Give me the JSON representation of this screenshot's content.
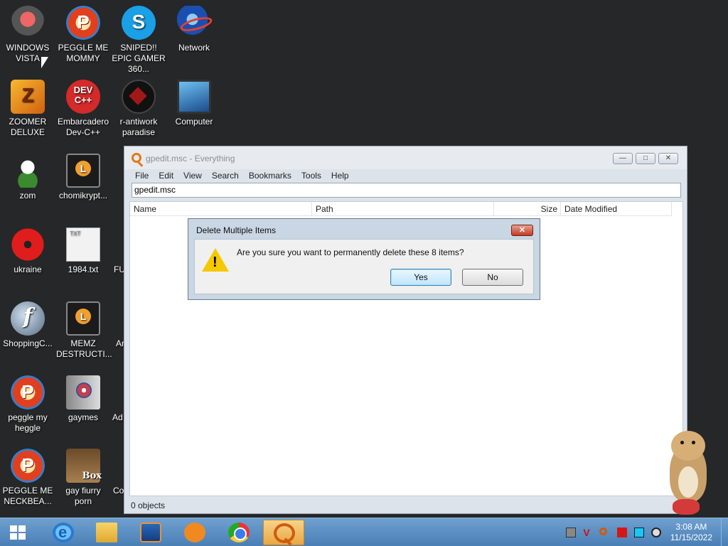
{
  "desktop_icons": [
    {
      "label": "WINDOWS VISTA",
      "icon": "windows-vista-icon"
    },
    {
      "label": "PEGGLE ME MOMMY",
      "icon": "peggle-icon"
    },
    {
      "label": "SNIPED!! EPIC GAMER 360...",
      "icon": "skype-icon"
    },
    {
      "label": "Network",
      "icon": "network-icon"
    },
    {
      "label": "ZOOMER DELUXE",
      "icon": "zoomer-icon"
    },
    {
      "label": "Embarcadero Dev-C++",
      "icon": "devcpp-icon"
    },
    {
      "label": "r-antiwork paradise",
      "icon": "antiwork-icon"
    },
    {
      "label": "Computer",
      "icon": "computer-icon"
    },
    {
      "label": "zom",
      "icon": "flower-icon"
    },
    {
      "label": "chomikrypt...",
      "icon": "document-clock-icon"
    },
    {
      "label": "ukraine",
      "icon": "radiation-icon"
    },
    {
      "label": "1984.txt",
      "icon": "text-file-icon"
    },
    {
      "label": "FU",
      "icon": "partial-icon"
    },
    {
      "label": "ShoppingC...",
      "icon": "flash-icon"
    },
    {
      "label": "MEMZ DESTRUCTI...",
      "icon": "document-clock-icon"
    },
    {
      "label": "Ar",
      "icon": "partial-icon"
    },
    {
      "label": "peggle my heggle",
      "icon": "peggle-icon"
    },
    {
      "label": "gaymes",
      "icon": "music-folder-icon"
    },
    {
      "label": "Ad",
      "icon": "partial-icon"
    },
    {
      "label": "PEGGLE ME NECKBEA...",
      "icon": "peggle-icon"
    },
    {
      "label": "gay fiurry porn",
      "icon": "box-icon"
    },
    {
      "label": "Co",
      "icon": "partial-icon"
    }
  ],
  "window": {
    "title": "gpedit.msc - Everything",
    "minimize": "—",
    "maximize": "□",
    "close": "✕",
    "menu": [
      "File",
      "Edit",
      "View",
      "Search",
      "Bookmarks",
      "Tools",
      "Help"
    ],
    "search_value": "gpedit.msc",
    "columns": [
      "Name",
      "Path",
      "Size",
      "Date Modified"
    ],
    "status": "0 objects"
  },
  "dialog": {
    "title": "Delete Multiple Items",
    "close": "✕",
    "message": "Are you sure you want to permanently delete these 8 items?",
    "yes_label": "Yes",
    "no_label": "No"
  },
  "taskbar": {
    "items": [
      "internet-explorer-icon",
      "file-explorer-icon",
      "media-player-icon",
      "uc-browser-icon",
      "chrome-icon",
      "everything-search-icon"
    ],
    "active_item": "everything-search-icon",
    "time": "3:08 AM",
    "date": "11/15/2022"
  },
  "colors": {
    "desktop": "#262728",
    "taskbar": "#5a8ec4",
    "dialog_frame": "#c9d6e4",
    "close_red": "#c23a23"
  }
}
